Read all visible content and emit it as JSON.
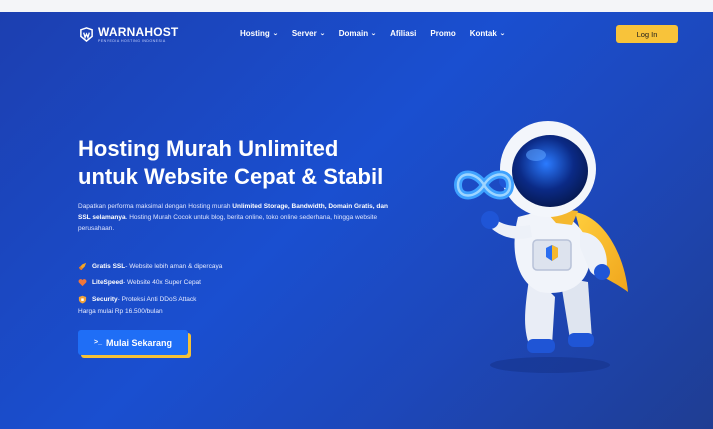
{
  "brand": {
    "name": "WARNAHOST",
    "tagline": "PENYEDIA HOSTING INDONESIA",
    "logo_icon": "warnahost-logo-icon"
  },
  "nav": {
    "items": [
      {
        "label": "Hosting",
        "dropdown": true
      },
      {
        "label": "Server",
        "dropdown": true
      },
      {
        "label": "Domain",
        "dropdown": true
      },
      {
        "label": "Afiliasi",
        "dropdown": false
      },
      {
        "label": "Promo",
        "dropdown": false
      },
      {
        "label": "Kontak",
        "dropdown": true
      }
    ],
    "login_label": "Log In"
  },
  "hero": {
    "title_line1": "Hosting Murah Unlimited",
    "title_line2": "untuk Website Cepat & Stabil",
    "desc_part1": "Dapatkan performa maksimal dengan Hosting murah ",
    "desc_bold1": "Unlimited Storage, Bandwidth, Domain Gratis, dan SSL selamanya",
    "desc_part2": ". Hosting Murah Cocok untuk blog, berita online, toko online sederhana, hingga website perusahaan.",
    "features": [
      {
        "icon": "rocket-icon",
        "title": "Gratis SSL",
        "text": " - Website lebih aman & dipercaya"
      },
      {
        "icon": "heart-icon",
        "title": "LiteSpeed",
        "text": " - Website 40x Super Cepat"
      },
      {
        "icon": "shield-icon",
        "title": "Security",
        "text": " - Proteksi Anti DDoS Attack"
      }
    ],
    "price_text": "Harga mulai Rp 16.500/bulan",
    "cta_label": "Mulai Sekarang",
    "cta_icon": "terminal-icon"
  },
  "colors": {
    "hero_bg": "#1a4fd0",
    "accent": "#f8c33a",
    "cta_bg": "#1f6ef6"
  }
}
